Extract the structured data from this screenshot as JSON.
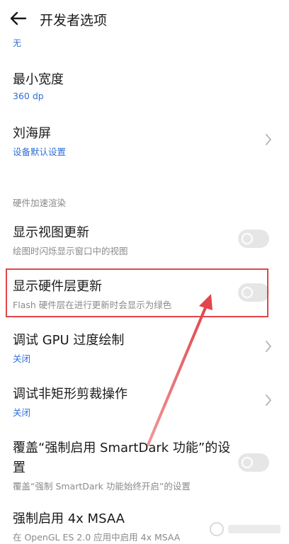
{
  "header": {
    "back_icon": "arrow-left-icon",
    "title": "开发者选项"
  },
  "clipped_item": {
    "subtitle": "无"
  },
  "items": [
    {
      "title": "最小宽度",
      "subtitle": "360 dp"
    },
    {
      "title": "刘海屏",
      "subtitle": "设备默认设置",
      "trailing": "chevron-right-icon"
    }
  ],
  "section": {
    "header": "硬件加速渲染",
    "items": [
      {
        "title": "显示视图更新",
        "subtitle": "绘图时闪烁显示窗口中的视图",
        "toggle": false
      },
      {
        "title": "显示硬件层更新",
        "subtitle": "Flash 硬件层在进行更新时会显示为绿色",
        "toggle": false
      },
      {
        "title": "调试 GPU 过度绘制",
        "subtitle": "关闭",
        "trailing": "chevron-right-icon"
      },
      {
        "title": "调试非矩形剪裁操作",
        "subtitle": "关闭",
        "trailing": "chevron-right-icon"
      },
      {
        "title_line1": "覆盖“强制启用 SmartDark 功能”的设",
        "title_line2": "置",
        "subtitle": "覆盖“强制 SmartDark 功能始终开启”的设置",
        "toggle": false
      },
      {
        "title": "强制启用 4x MSAA",
        "subtitle": "在 OpenGL ES 2.0 应用中启用 4x MSAA"
      }
    ]
  },
  "annotation": {
    "color": "#e2454a"
  },
  "colors": {
    "accent_blue": "#2f6fd6",
    "secondary_gray": "#8a8a8a",
    "toggle_off": "#e6e6e6"
  }
}
